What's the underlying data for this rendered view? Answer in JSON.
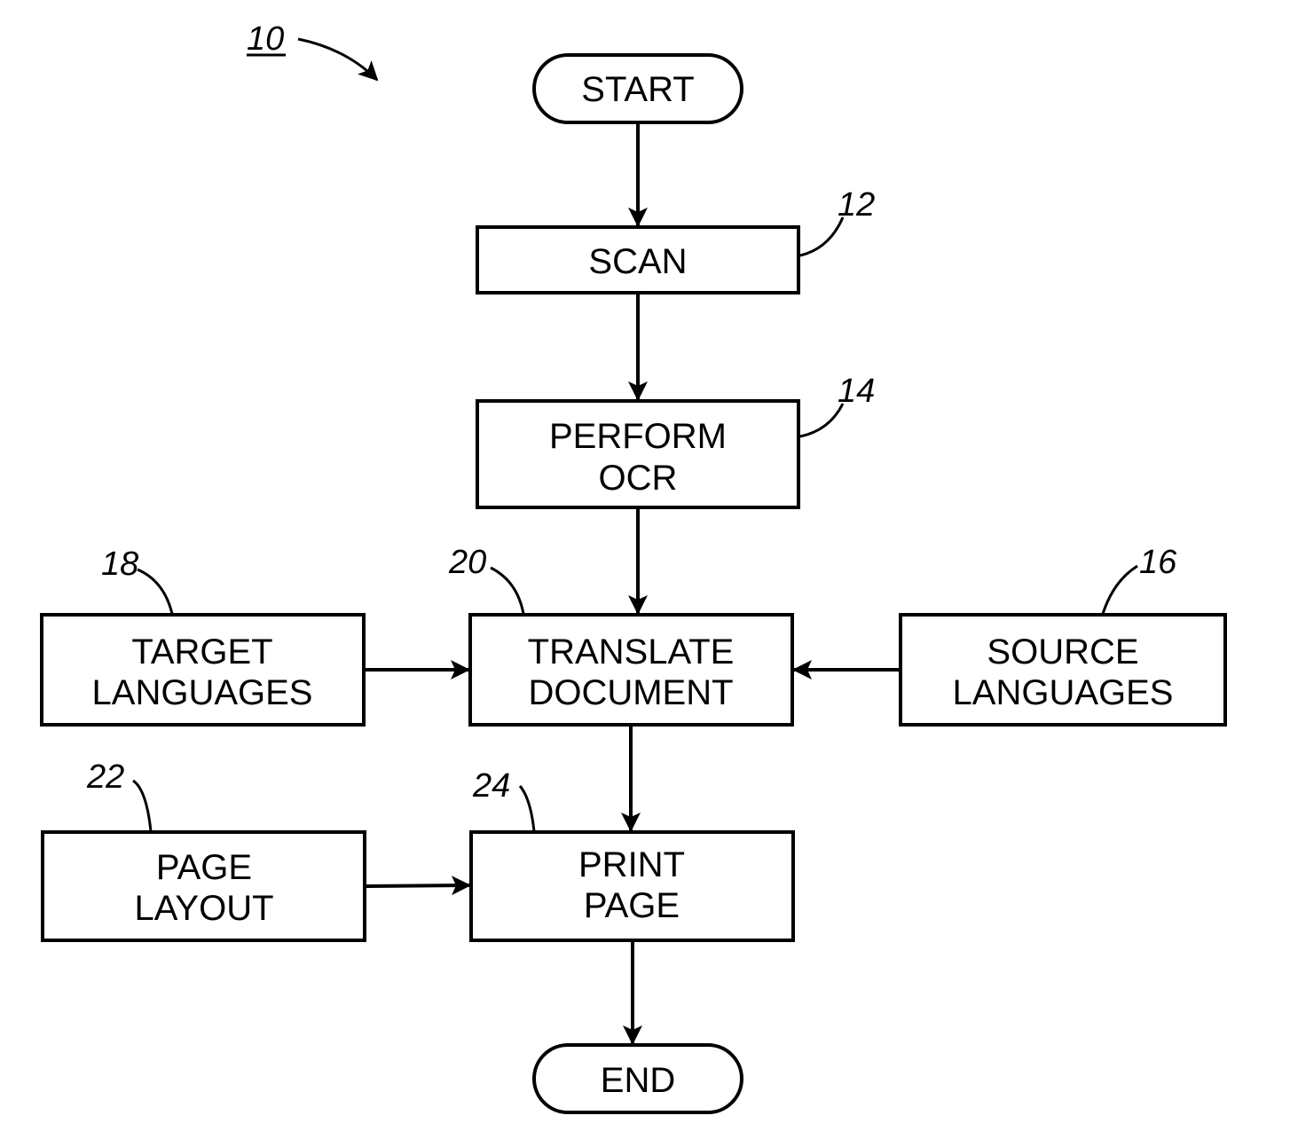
{
  "figure": {
    "reference": "10",
    "nodes": {
      "start": {
        "label": "START",
        "shape": "terminal"
      },
      "scan": {
        "ref": "12",
        "lines": [
          "SCAN"
        ]
      },
      "ocr": {
        "ref": "14",
        "lines": [
          "PERFORM",
          "OCR"
        ]
      },
      "source": {
        "ref": "16",
        "lines": [
          "SOURCE",
          "LANGUAGES"
        ]
      },
      "target": {
        "ref": "18",
        "lines": [
          "TARGET",
          "LANGUAGES"
        ]
      },
      "translate": {
        "ref": "20",
        "lines": [
          "TRANSLATE",
          "DOCUMENT"
        ]
      },
      "layout": {
        "ref": "22",
        "lines": [
          "PAGE",
          "LAYOUT"
        ]
      },
      "print": {
        "ref": "24",
        "lines": [
          "PRINT",
          "PAGE"
        ]
      },
      "end": {
        "label": "END",
        "shape": "terminal"
      }
    },
    "edges": [
      {
        "from": "start",
        "to": "scan"
      },
      {
        "from": "scan",
        "to": "ocr"
      },
      {
        "from": "ocr",
        "to": "translate"
      },
      {
        "from": "target",
        "to": "translate"
      },
      {
        "from": "source",
        "to": "translate"
      },
      {
        "from": "translate",
        "to": "print"
      },
      {
        "from": "layout",
        "to": "print"
      },
      {
        "from": "print",
        "to": "end"
      }
    ]
  }
}
